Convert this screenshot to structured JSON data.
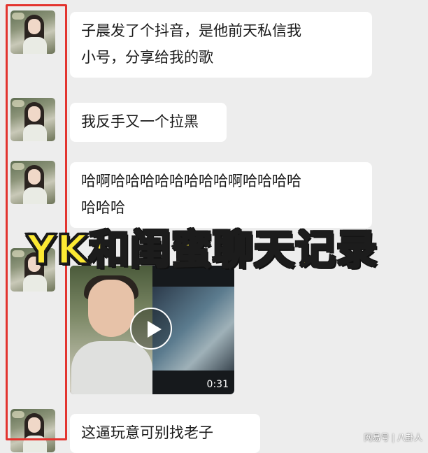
{
  "messages": [
    {
      "text": "子晨发了个抖音，是他前天私信我\n小号，分享给我的歌"
    },
    {
      "text": "我反手又一个拉黑"
    },
    {
      "text": "哈啊哈哈哈哈哈哈哈哈啊哈哈哈哈\n哈哈哈"
    },
    {
      "text": "这逼玩意可别找老子"
    }
  ],
  "video": {
    "duration": "0:31"
  },
  "overlay_caption": "YK和闺蜜聊天记录",
  "watermark": "网易号 | 八卦人",
  "colors": {
    "background": "#ededed",
    "bubble": "#ffffff",
    "caption": "#fce933",
    "highlight_box": "#e3342f"
  }
}
